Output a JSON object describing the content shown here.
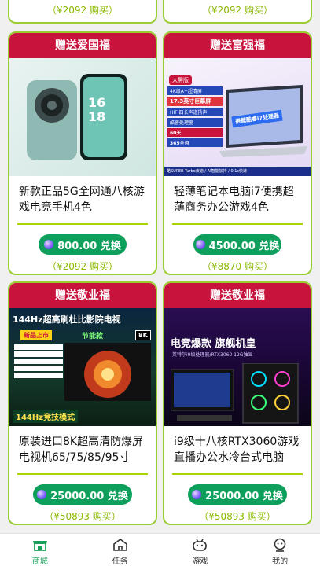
{
  "top_refs": [
    "（¥2092 购买）",
    "（¥2092 购买）"
  ],
  "cards": [
    {
      "ribbon": "赠送爱国福",
      "title": "新款正品5G全网通八核游戏电竞手机4色",
      "price": "800.00 兑换",
      "ref": "（¥2092 购买）",
      "image": "phone"
    },
    {
      "ribbon": "赠送富强福",
      "title": "轻薄笔记本电脑i7便携超薄商务办公游戏4色",
      "price": "4500.00 兑换",
      "ref": "（¥8870 购买）",
      "image": "laptop",
      "img_text": {
        "badge": "大屏版",
        "l1": "4K级A+超清屏",
        "l2": "17.3英寸巨幕屏",
        "l3": "HIFI四长声道扬声",
        "l4": "酷睿处理器",
        "l5": "60天",
        "l6": "365全包",
        "banner": "搭载酷睿i7处理器",
        "bottom": "酷SUPER Turbo疾速 / AI智能加持 / 0.1s快速"
      }
    },
    {
      "ribbon": "赠送敬业福",
      "title": "原装进口8K超高清防爆屏电视机65/75/85/95寸",
      "price": "25000.00 兑换",
      "ref": "（¥50893 购买）",
      "image": "tv",
      "img_text": {
        "head": "144Hz超高刷杜比影院电视",
        "new": "新品上市",
        "energy": "节能款",
        "badge": "8K",
        "bottom": "144Hz竞技模式"
      }
    },
    {
      "ribbon": "赠送敬业福",
      "title": "i9级十八核RTX3060游戏直播办公水冷台式电脑",
      "price": "25000.00 兑换",
      "ref": "（¥50893 购买）",
      "image": "pc",
      "img_text": {
        "head": "电竞爆款 旗舰机皇",
        "sub": "英特尔i9级处理器/RTX3060 12G独显"
      }
    }
  ],
  "tabs": [
    {
      "label": "商城",
      "icon": "store-icon",
      "active": true
    },
    {
      "label": "任务",
      "icon": "home-icon",
      "active": false
    },
    {
      "label": "游戏",
      "icon": "game-icon",
      "active": false
    },
    {
      "label": "我的",
      "icon": "user-icon",
      "active": false
    }
  ],
  "colors": {
    "ribbon": "#c8143c",
    "border": "#9acd32",
    "pill": "#0d9f5b",
    "accent": "#19a05b"
  }
}
